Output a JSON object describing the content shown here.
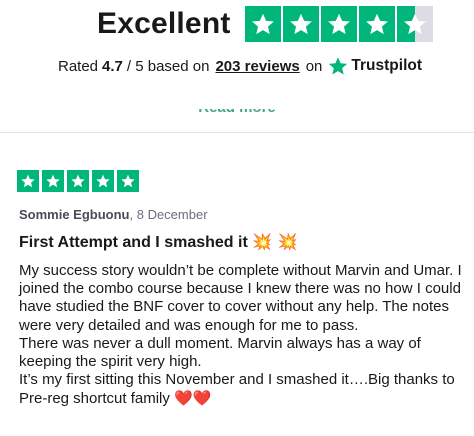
{
  "header": {
    "rating_word": "Excellent",
    "stars_filled": 4.5,
    "summary_prefix": "Rated",
    "score": "4.7",
    "summary_middle": "/ 5 based on",
    "reviews_link": "203 reviews",
    "summary_on": "on",
    "brand": "Trustpilot",
    "read_more": "Read more"
  },
  "review": {
    "stars": 5,
    "author": "Sommie Egbuonu",
    "date": ", 8 December",
    "title": "First Attempt and I smashed it",
    "title_emoji": "💥  💥",
    "paragraphs": [
      "My success story wouldn’t be complete without Marvin and Umar. I joined the combo course because I knew there was no how I could have studied the BNF cover to cover without any help. The notes were very detailed and was enough for me to pass.",
      "There was never a dull moment. Marvin always has a way of keeping the spirit very high.",
      "It’s my first sitting this November and I smashed it….Big thanks to Pre-reg shortcut family"
    ],
    "closing_emoji": "❤️❤️"
  },
  "colors": {
    "trustpilot_green": "#00b67a",
    "star_empty": "#dcdce6",
    "text": "#191919",
    "muted": "#6c6c85"
  }
}
